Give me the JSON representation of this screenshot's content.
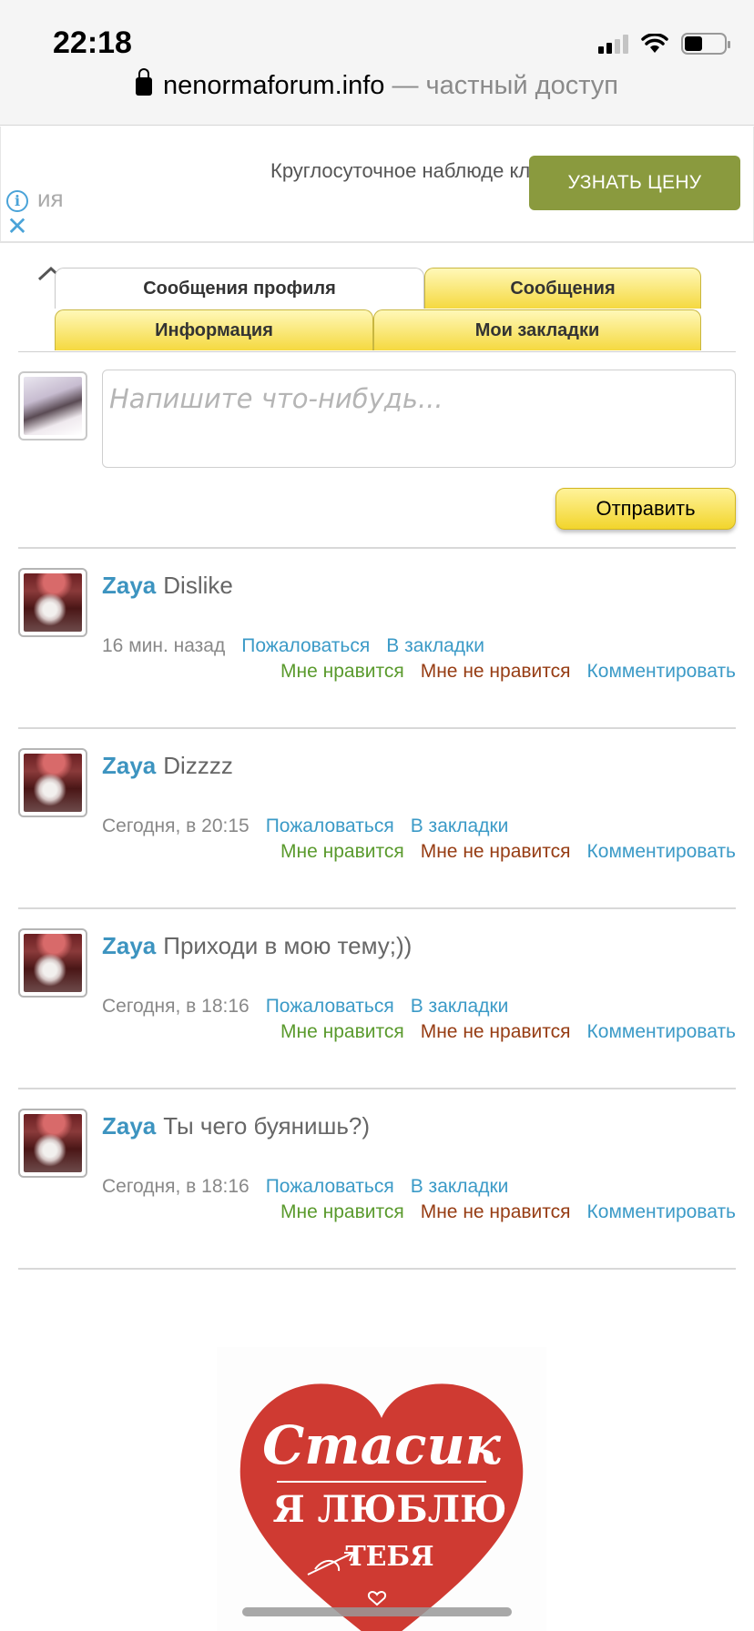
{
  "status_bar": {
    "time": "22:18",
    "battery_level": 0.45,
    "signal_bars": 2
  },
  "address_bar": {
    "domain": "nenormaforum.info",
    "suffix": "— частный доступ"
  },
  "ad": {
    "text": "Круглосуточное наблюде клинике. Без групповых",
    "fragment": "ия",
    "button_label": "УЗНАТЬ ЦЕНУ",
    "icons": [
      "info-icon",
      "close-icon"
    ]
  },
  "tabs": [
    {
      "label": "Сообщения профиля",
      "active": true
    },
    {
      "label": "Сообщения",
      "active": false
    },
    {
      "label": "Информация",
      "active": false
    },
    {
      "label": "Мои закладки",
      "active": false
    }
  ],
  "composer": {
    "placeholder": "Напишите что-нибудь...",
    "submit_label": "Отправить"
  },
  "post_actions": {
    "report": "Пожаловаться",
    "bookmark": "В закладки",
    "like": "Мне нравится",
    "dislike": "Мне не нравится",
    "comment": "Комментировать"
  },
  "posts": [
    {
      "author": "Zaya",
      "text": "Dislike",
      "time": "16 мин. назад"
    },
    {
      "author": "Zaya",
      "text": "Dizzzz",
      "time": "Сегодня, в 20:15"
    },
    {
      "author": "Zaya",
      "text": "Приходи в мою тему;))",
      "time": "Сегодня, в 18:16"
    },
    {
      "author": "Zaya",
      "text": "Ты чего буянишь?)",
      "time": "Сегодня, в 18:16"
    }
  ],
  "banner": {
    "line1": "Стасик",
    "line2": "Я ЛЮБЛЮ",
    "line3": "ТЕБЯ",
    "heart_color": "#cf3a32"
  },
  "colors": {
    "link": "#3b9ac7",
    "like": "#5a9a2d",
    "dislike": "#963c13",
    "tab_yellow": "#f5d940",
    "ad_button": "#8a9a3e"
  }
}
